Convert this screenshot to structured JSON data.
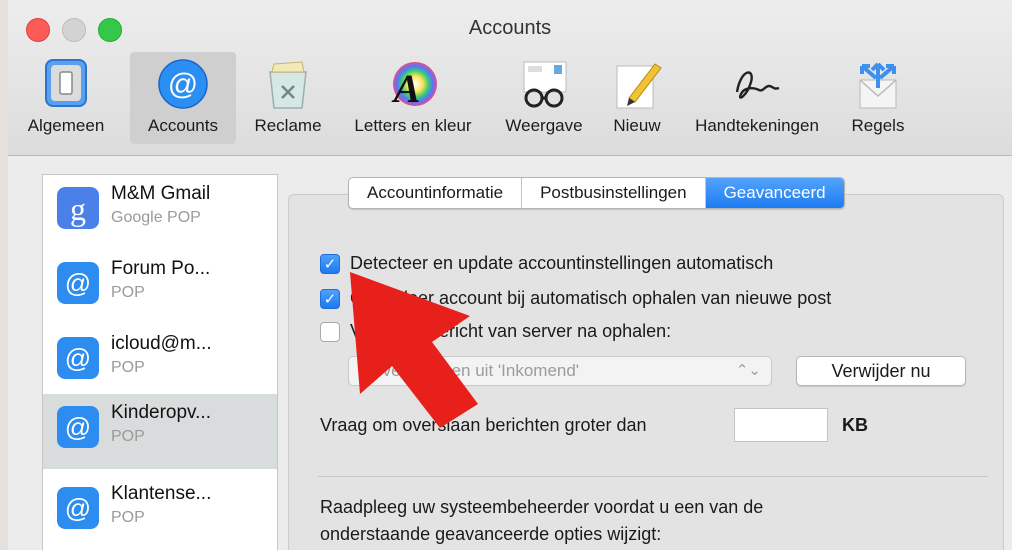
{
  "window": {
    "title": "Accounts"
  },
  "toolbar": {
    "items": [
      {
        "label": "Algemeen",
        "icon": "switch-icon"
      },
      {
        "label": "Accounts",
        "icon": "at-sign-icon",
        "selected": true
      },
      {
        "label": "Reclame",
        "icon": "trash-icon"
      },
      {
        "label": "Letters en kleur",
        "icon": "font-color-icon"
      },
      {
        "label": "Weergave",
        "icon": "glasses-icon"
      },
      {
        "label": "Nieuw",
        "icon": "compose-icon"
      },
      {
        "label": "Handtekeningen",
        "icon": "signature-icon"
      },
      {
        "label": "Regels",
        "icon": "rules-icon"
      }
    ]
  },
  "accounts": [
    {
      "name": "M&M Gmail",
      "type": "Google POP",
      "icon": "google-icon"
    },
    {
      "name": "Forum Po...",
      "type": "POP",
      "icon": "at-sign-icon"
    },
    {
      "name": "icloud@m...",
      "type": "POP",
      "icon": "at-sign-icon"
    },
    {
      "name": "Kinderopv...",
      "type": "POP",
      "icon": "at-sign-icon",
      "selected": true
    },
    {
      "name": "Klantense...",
      "type": "POP",
      "icon": "at-sign-icon"
    }
  ],
  "tabs": [
    {
      "label": "Accountinformatie"
    },
    {
      "label": "Postbusinstellingen"
    },
    {
      "label": "Geavanceerd",
      "active": true
    }
  ],
  "options": {
    "auto_detect": {
      "label": "Detecteer en update accountinstellingen automatisch",
      "checked": true
    },
    "check_account": {
      "label": "Controleer account bij automatisch ophalen van nieuwe post",
      "checked": true
    },
    "delete_after": {
      "label": "Verwijder bericht van server na ophalen:",
      "checked": false
    },
    "delete_when": {
      "value": "Bij verplaatsen uit 'Inkomend'"
    },
    "delete_now_label": "Verwijder nu",
    "size_prompt": {
      "label": "Vraag om overslaan berichten groter dan",
      "value": "",
      "unit": "KB"
    },
    "advice_line1": "Raadpleeg uw systeembeheerder voordat u een van de",
    "advice_line2": "onderstaande geavanceerde opties wijzigt:"
  },
  "colors": {
    "accent": "#1d7cf2",
    "annotation_arrow": "#e8201c"
  }
}
